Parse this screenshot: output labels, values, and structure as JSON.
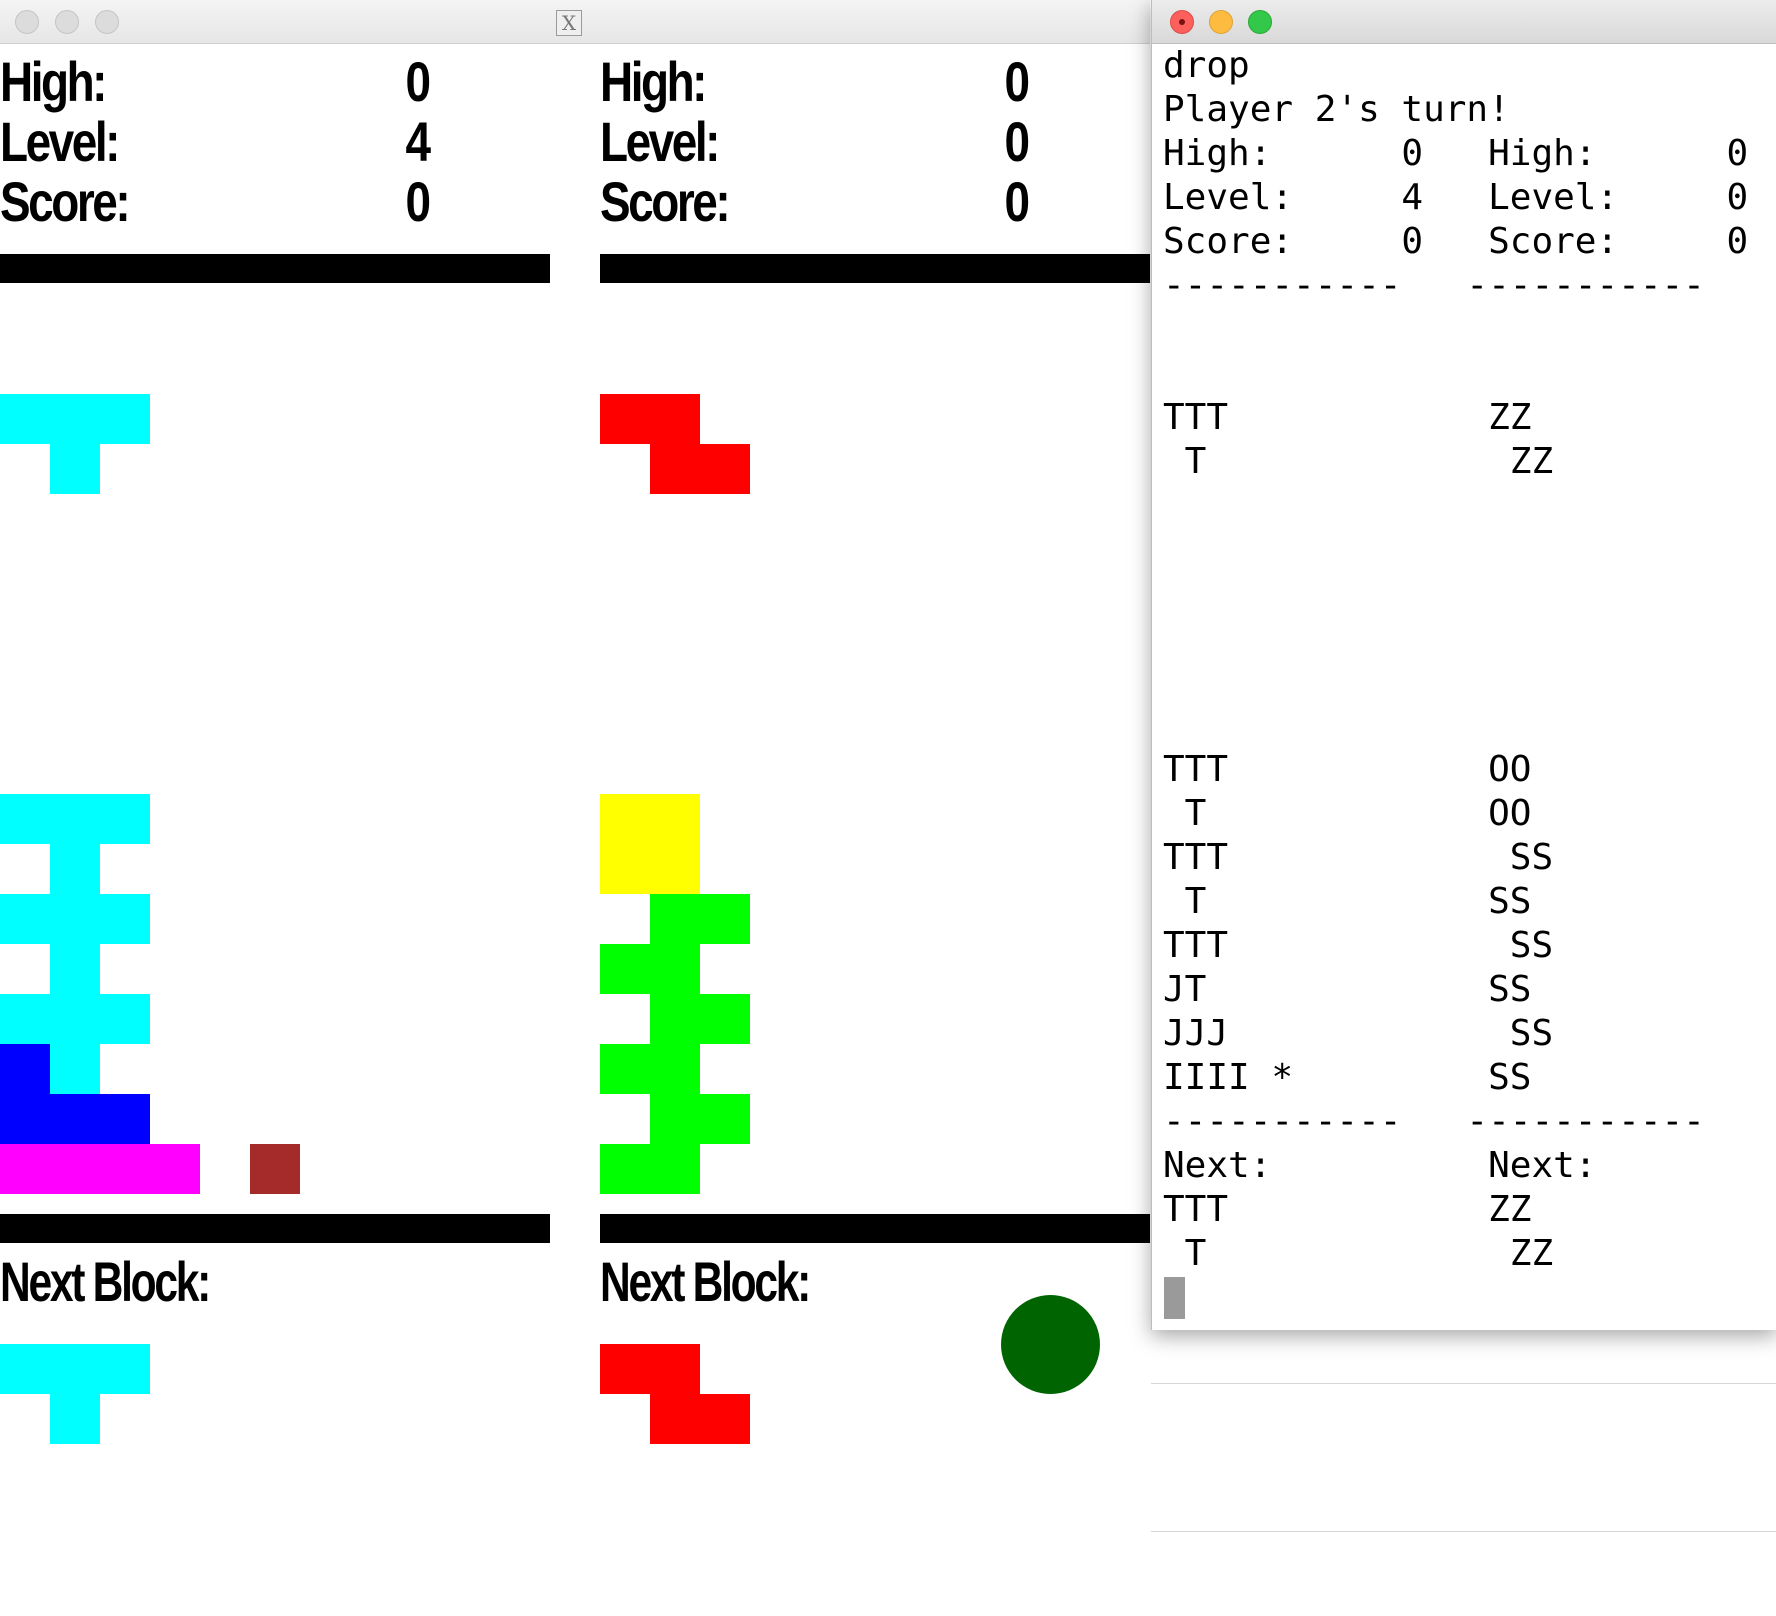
{
  "game_window": {
    "logo": "X",
    "player1": {
      "high_label": "High:",
      "high": "0",
      "level_label": "Level:",
      "level": "4",
      "score_label": "Score:",
      "score": "0",
      "next_label": "Next Block:"
    },
    "player2": {
      "high_label": "High:",
      "high": "0",
      "level_label": "Level:",
      "level": "0",
      "score_label": "Score:",
      "score": "0",
      "next_label": "Next Block:"
    },
    "colors": {
      "T": "#00ffff",
      "Z": "#ff0000",
      "O": "#ffff00",
      "S": "#00ff00",
      "J": "#0000ff",
      "I": "#ff00ff",
      "star": "#a52a2a",
      "indicator": "#006400"
    }
  },
  "terminal": {
    "lines": [
      "drop",
      "Player 2's turn!",
      "High:      0   High:      0",
      "Level:     4   Level:     0",
      "Score:     0   Score:     0",
      "-----------   -----------",
      "",
      "",
      "TTT            ZZ",
      " T              ZZ",
      "",
      "",
      "",
      "",
      "",
      "",
      "TTT            OO",
      " T             OO",
      "TTT             SS",
      " T             SS",
      "TTT             SS",
      "JT             SS",
      "JJJ             SS",
      "IIII *         SS",
      "-----------   -----------",
      "Next:          Next:",
      "TTT            ZZ",
      " T              ZZ"
    ]
  }
}
